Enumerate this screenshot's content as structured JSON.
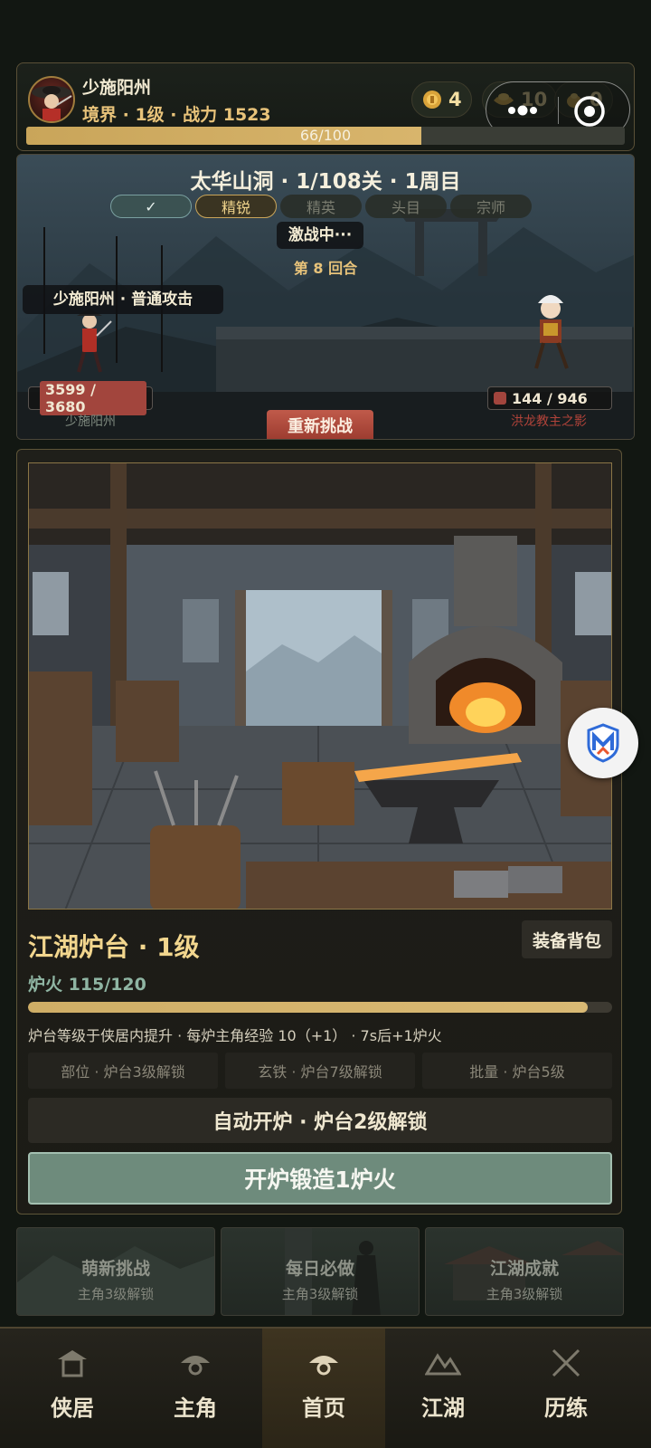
{
  "header": {
    "player_name": "少施阳州",
    "stats_line": "境界 · 1级 · 战力 1523",
    "currencies": [
      {
        "icon": "copper-coin-icon",
        "value": "4"
      },
      {
        "icon": "gold-ingot-icon",
        "value": "10"
      },
      {
        "icon": "silver-ingot-icon",
        "value": "0"
      }
    ],
    "exp": {
      "text": "66/100",
      "current": 66,
      "max": 100
    }
  },
  "battle": {
    "stage_title": "太华山洞 · 1/108关 · 1周目",
    "tabs": [
      {
        "label": "✓",
        "state": "done"
      },
      {
        "label": "精锐",
        "state": "active"
      },
      {
        "label": "精英",
        "state": "locked"
      },
      {
        "label": "头目",
        "state": "locked"
      },
      {
        "label": "宗师",
        "state": "locked"
      }
    ],
    "status": "激战中···",
    "round": "第 8 回合",
    "action_bubble": "少施阳州 · 普通攻击",
    "player": {
      "hp_text": "3599 / 3680",
      "hp": 3599,
      "hp_max": 3680,
      "name": "少施阳州"
    },
    "enemy": {
      "hp_text": "144 / 946",
      "hp": 144,
      "hp_max": 946,
      "name": "洪龙教主之影"
    },
    "retry_label": "重新挑战"
  },
  "forge": {
    "title": "江湖炉台 · 1级",
    "bag_label": "装备背包",
    "fire_text": "炉火 115/120",
    "fire_current": 115,
    "fire_max": 120,
    "description": "炉台等级于侠居内提升 · 每炉主角经验 10（+1） · 7s后+1炉火",
    "locked_slots": [
      "部位 · 炉台3级解锁",
      "玄铁 · 炉台7级解锁",
      "批量 · 炉台5级"
    ],
    "auto_label": "自动开炉 · 炉台2级解锁",
    "forge_button": "开炉锻造1炉火"
  },
  "cards": [
    {
      "title": "萌新挑战",
      "sub": "主角3级解锁"
    },
    {
      "title": "每日必做",
      "sub": "主角3级解锁"
    },
    {
      "title": "江湖成就",
      "sub": "主角3级解锁"
    }
  ],
  "nav": {
    "items": [
      {
        "label": "侠居",
        "icon": "house-icon"
      },
      {
        "label": "主角",
        "icon": "hat-icon"
      },
      {
        "label": "首页",
        "icon": "hat-icon"
      },
      {
        "label": "江湖",
        "icon": "mountain-icon"
      },
      {
        "label": "历练",
        "icon": "crossed-swords-icon"
      }
    ],
    "active_index": 2
  },
  "colors": {
    "accent_gold": "#e8c37a",
    "forge_button": "#6e8b7c",
    "retry_button": "#9b3b2f",
    "hp_red": "#a2453d"
  }
}
